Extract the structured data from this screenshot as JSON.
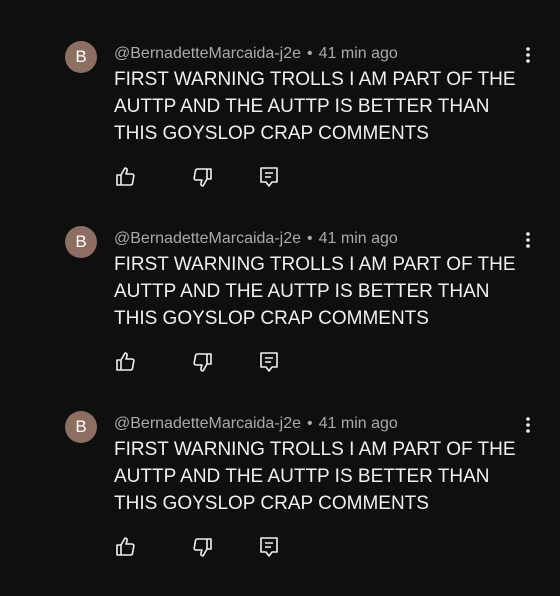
{
  "comments": [
    {
      "avatar_letter": "B",
      "author": "@BernadetteMarcaida-j2e",
      "separator": "•",
      "time": "41 min ago",
      "text": "FIRST WARNING TROLLS I AM PART OF THE AUTTP AND THE AUTTP IS BETTER THAN THIS GOYSLOP CRAP COMMENTS"
    },
    {
      "avatar_letter": "B",
      "author": "@BernadetteMarcaida-j2e",
      "separator": "•",
      "time": "41 min ago",
      "text": "FIRST WARNING TROLLS I AM PART OF THE AUTTP AND THE AUTTP IS BETTER THAN THIS GOYSLOP CRAP COMMENTS"
    },
    {
      "avatar_letter": "B",
      "author": "@BernadetteMarcaida-j2e",
      "separator": "•",
      "time": "41 min ago",
      "text": "FIRST WARNING TROLLS I AM PART OF THE AUTTP AND THE AUTTP IS BETTER THAN THIS GOYSLOP CRAP COMMENTS"
    }
  ],
  "icons": {
    "like": "thumbs-up-icon",
    "dislike": "thumbs-down-icon",
    "reply": "reply-icon",
    "more": "more-vertical-icon"
  },
  "colors": {
    "background": "#0f0f0f",
    "text": "#f1f1f1",
    "secondary_text": "#aaaaaa",
    "avatar": "#8c6e62"
  }
}
